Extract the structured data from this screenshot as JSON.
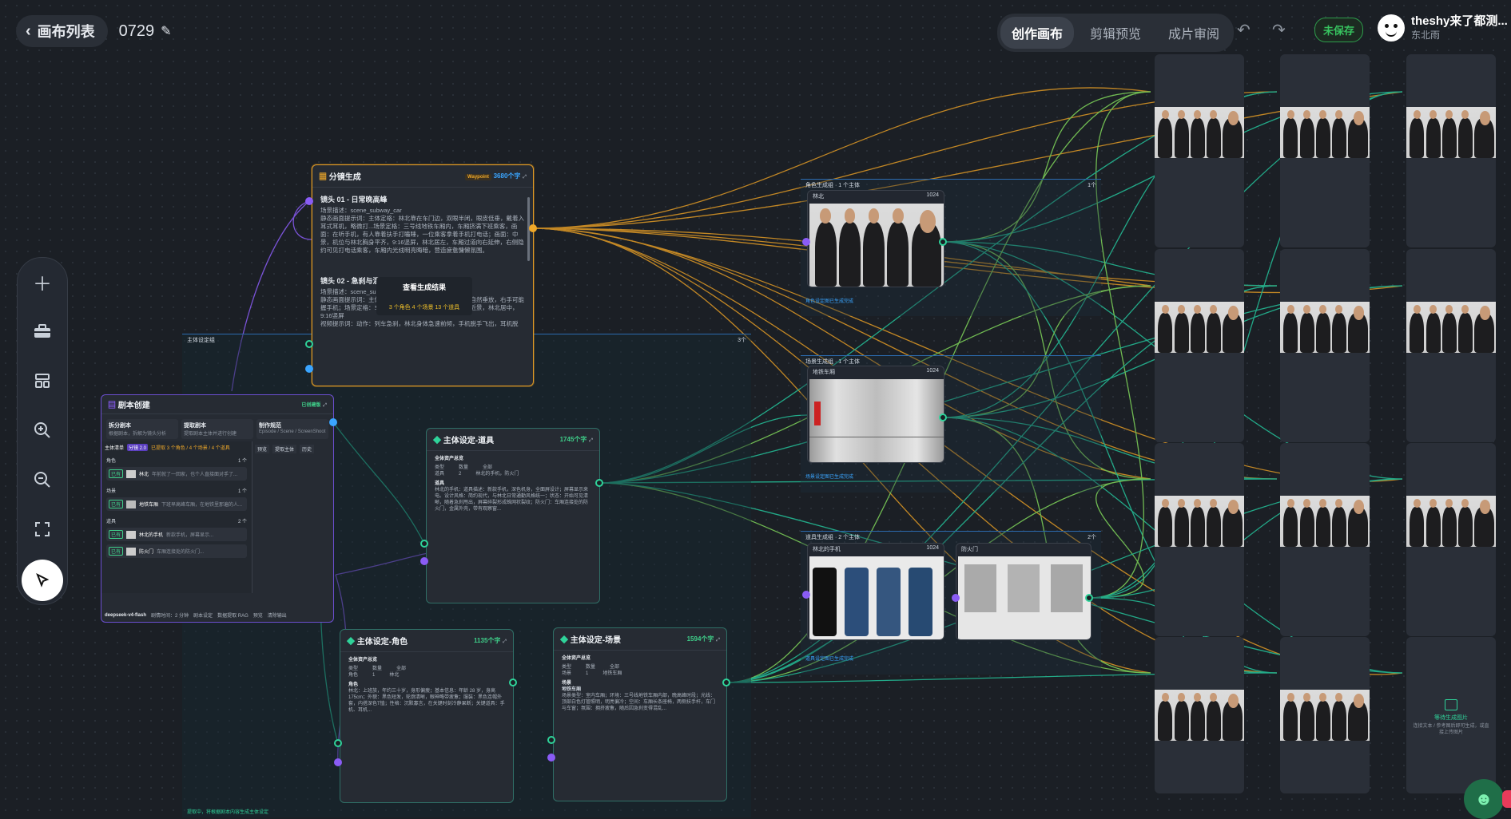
{
  "header": {
    "back_label": "画布列表",
    "project_name": "0729",
    "tabs": [
      {
        "label": "创作画布",
        "active": true
      },
      {
        "label": "剪辑预览",
        "active": false
      },
      {
        "label": "成片审阅",
        "active": false
      }
    ],
    "save_status": "未保存",
    "user_name": "theshy来了都测...",
    "user_sub": "东北雨"
  },
  "toolbar": {
    "items": [
      "add-icon",
      "toolbox-icon",
      "layout-icon",
      "zoom-in-icon",
      "zoom-out-icon",
      "fit-icon",
      "select-cursor-icon"
    ]
  },
  "nodes": {
    "shot_gen": {
      "title": "分镜生成",
      "badge": "Waypoint",
      "count": "3680个字",
      "shot1_title": "镜头 01 - 日常晚高峰",
      "shot1_scene": "场景描述：scene_subway_car",
      "shot1_text": "静态画面提示词：主体定格：林北靠在车门边，双眼半闭，眼皮低垂，戴着入耳式耳机，略微打...场景定格：三号线地铁车厢内，车厢挤满下班乘客，画面：在听手机，有人靠着扶手打瞌睡，一位乘客拿着手机打电话；画面：中景，机位与林北胸身平齐，9:16竖屏，林北居左，车厢过道向右延伸，右侧隐约可见打电话乘客，车厢内光线明亮晦暗，营造疲惫慵懒氛围。",
      "popup_label": "查看生成结果",
      "popup_stats": "3 个角色 4 个场景 13 个道具",
      "shot2_title": "镜头 02 - 急刹与混乱",
      "shot2_scene": "场景描述：scene_subway_car",
      "shot2_text": "静态画面提示词：主体定格：林北靠立，表情平静，双手自然垂放，右手可能握手机；场景定格：车厢内灯管亮，灯光正常；画面：中近景，林北居中，9:16竖屏",
      "shot2_text2": "视频提示词：动作：列车急刹，林北身体急速前倾，手机脱手飞出，耳机脱"
    },
    "script_node": {
      "title": "剧本创建",
      "tag": "已创建版",
      "opt1": "拆分剧本",
      "opt1_sub": "根据剧本，拆解为镜头分析",
      "opt2": "提取剧本",
      "opt2_sub": "提取剧本主体并进行创建",
      "opt3": "制作规范",
      "opt3_sub": "Episode / Scene / ScreenShoot",
      "model": "deepseek-v4-flash",
      "foot_items": [
        "剧情时间：2 分钟",
        "剧本设定",
        "数据提取 RAG",
        "预览",
        "清除输出"
      ]
    },
    "subject_list": {
      "title": "主体清单",
      "tabs": [
        "主体清单",
        "分镜 2.0",
        "已提取 3 个角色 / 4 个场景 / 4 个道具"
      ],
      "actions": [
        "预览",
        "提取主体",
        "历史"
      ],
      "sec_role": "角色",
      "sec_role_n": "1 个",
      "role_name": "林北",
      "role_desc": "年前就了一回家，也个人直接面对手了...",
      "sec_scene": "场景",
      "sec_scene_n": "1 个",
      "scene_name": "地铁车厢",
      "scene_desc": "下班早高峰车厢，在地铁里那遍的人...",
      "sec_prop": "道具",
      "sec_prop_n": "2 个",
      "prop1_name": "林北的手机",
      "prop1_desc": "新款手机，屏幕显示...",
      "prop2_name": "防火门",
      "prop2_desc": "车厢连接处的防火门...",
      "status_label": "已有"
    },
    "subject_prop": {
      "title": "主体设定-道具",
      "count": "1745个字",
      "table_title": "全体资产总览",
      "cols": [
        "类型",
        "数量",
        "全部"
      ],
      "row": [
        "道具",
        "2",
        "林北的手机，防火门"
      ],
      "section": "道具",
      "body": "林北的手机：道具描述：新款手机，深色机身，全面屏设计；屏幕显示来电。设计风格：简约现代，与林北日常通勤风格统一；状态：开始可见清晰，随着急刹甩出，屏幕碎裂形成蛛网状裂纹；防火门：车厢连接处的防火门，金属外壳，带有观察窗..."
    },
    "subject_role": {
      "title": "主体设定-角色",
      "count": "1135个字",
      "table_title": "全体资产总览",
      "cols": [
        "类型",
        "数量",
        "全部"
      ],
      "row": [
        "角色",
        "1",
        "林北"
      ],
      "section": "角色",
      "body": "林北：上班族，年约三十岁，身形偏瘦；基本信息：年龄 28 岁，身高 175cm；外貌：黑色短发，轮廓清晰，眼神略带疲惫；服装：黑色连帽外套，内搭深色T恤；性格：沉默寡言，在关键时刻冷静果断；关键道具：手机、耳机..."
    },
    "subject_scene": {
      "title": "主体设定-场景",
      "count": "1594个字",
      "table_title": "全体资产总览",
      "cols": [
        "类型",
        "数量",
        "全部"
      ],
      "row": [
        "场景",
        "1",
        "地铁车厢"
      ],
      "section": "场景",
      "sub": "地铁车厢",
      "body": "场景类型：室内车厢；环境：三号线地铁车厢内部，晚高峰时段；光线：顶部白色灯管照明，明亮偏冷；空间：车厢长条座椅，两侧扶手杆，车门与车窗；氛围：拥挤疲惫，随后因急刹变得混乱..."
    },
    "group_main": {
      "title": "主体设定组",
      "count": "3个"
    },
    "group_role": {
      "title": "角色生成组 · 1 个主体",
      "count": "1个",
      "item_name": "林北",
      "item_size": "1024",
      "caption": "角色设定图已生成完成"
    },
    "group_scene": {
      "title": "场景生成组 · 1 个主体",
      "item_name": "地铁车厢",
      "item_size": "1024",
      "caption": "场景设定图已生成完成"
    },
    "group_prop": {
      "title": "道具生成组 · 2 个主体",
      "count": "2个",
      "item1_name": "林北的手机",
      "item1_size": "1024",
      "item2_name": "防火门",
      "caption": "道具设定图已生成完成"
    },
    "empty_card": {
      "label": "等待生成图片",
      "sub": "连接文本 / 参考图后即可生成，或直接上传图片"
    },
    "bottom_caption": "提取中，将根据剧本内容生成主体设定"
  },
  "colors": {
    "accent_orange": "#f0a92a",
    "accent_green": "#2fd39a",
    "accent_purple": "#8a5cf5",
    "accent_blue": "#3aa5ff",
    "save_green": "#37c35f"
  }
}
